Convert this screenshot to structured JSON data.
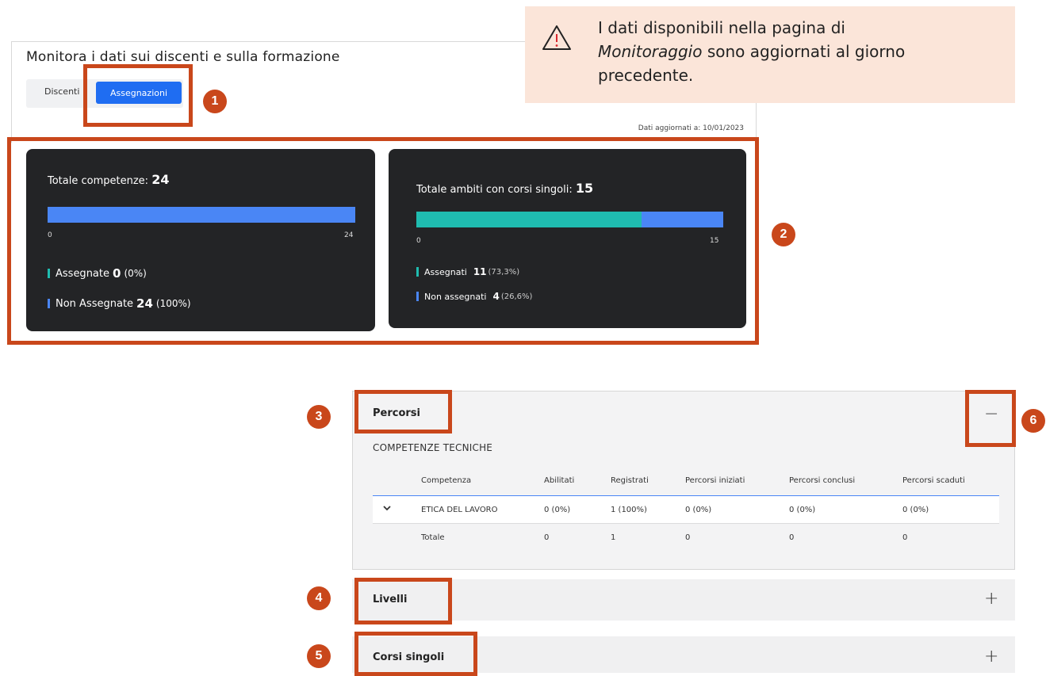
{
  "notice": {
    "line1": "I dati disponibili nella pagina di",
    "line2_italic": "Monitoraggio",
    "line2_rest": " sono aggiornati al giorno",
    "line3": "precedente."
  },
  "header": {
    "title": "Monitora i dati sui discenti e sulla formazione",
    "tabs": [
      "Discenti",
      "Assegnazioni"
    ],
    "active_tab": "Assegnazioni",
    "updated": "Dati aggiornati a: 10/01/2023"
  },
  "card_competenze": {
    "title": "Totale competenze: ",
    "total": "24",
    "tick_min": "0",
    "tick_max": "24",
    "assigned_fraction": 0.0,
    "assigned_label": "Assegnate",
    "assigned_value": "0",
    "assigned_pct": "(0%)",
    "unassigned_label": "Non Assegnate",
    "unassigned_value": "24",
    "unassigned_pct": "(100%)"
  },
  "card_ambiti": {
    "title": "Totale ambiti con corsi singoli: ",
    "total": "15",
    "tick_min": "0",
    "tick_max": "15",
    "assigned_fraction": 0.733,
    "assigned_label": "Assegnati",
    "assigned_value": "11",
    "assigned_pct": "(73,3%)",
    "unassigned_label": "Non assegnati",
    "unassigned_value": "4",
    "unassigned_pct": "(26,6%)"
  },
  "accordion": {
    "percorsi": "Percorsi",
    "percorsi_sign": "−",
    "section": "COMPETENZE TECNICHE",
    "columns": [
      "Competenza",
      "Abilitati",
      "Registrati",
      "Percorsi iniziati",
      "Percorsi conclusi",
      "Percorsi scaduti"
    ],
    "row": [
      "ETICA DEL LAVORO",
      "0 (0%)",
      "1 (100%)",
      "0 (0%)",
      "0 (0%)",
      "0 (0%)"
    ],
    "total_row": [
      "Totale",
      "0",
      "1",
      "0",
      "0",
      "0"
    ],
    "livelli": "Livelli",
    "livelli_sign": "+",
    "corsi": "Corsi singoli",
    "corsi_sign": "+"
  },
  "badges": [
    "1",
    "2",
    "3",
    "4",
    "5",
    "6"
  ],
  "colors": {
    "primary": "#1f6df2",
    "bar_blue": "#4a86f5",
    "bar_teal": "#1fbcb0",
    "highlight": "#c9471b",
    "card_bg": "#232426",
    "notice_bg": "#fbe5d9"
  }
}
